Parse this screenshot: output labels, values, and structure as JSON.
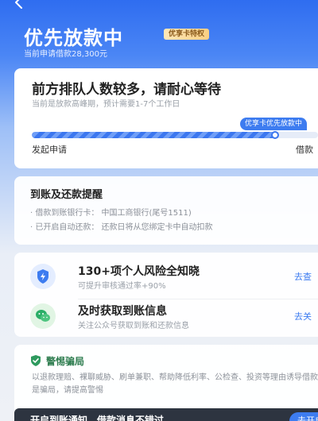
{
  "header": {
    "back_icon": "chevron-left-icon",
    "title": "优先放款中",
    "badge": "优享卡特权",
    "subtitle": "当前申请借款28,300元"
  },
  "queue": {
    "title": "前方排队人数较多，请耐心等待",
    "subtitle": "当前是放款高峰期，预计需要1-7个工作日",
    "tip": "优享卡优先放款中",
    "progress": 0.85,
    "start_label": "发起申请",
    "end_label": "借款"
  },
  "reminder": {
    "title": "到账及还款提醒",
    "line1": "· 借款到账银行卡：  中国工商银行(尾号1511)",
    "line2": "· 已开启自动还款：  还款日将从您绑定卡中自动扣款"
  },
  "features": [
    {
      "icon": "shield-lightning-icon",
      "title": "130+项个人风险全知晓",
      "desc": "可提升审核通过率+90%",
      "action": "去查"
    },
    {
      "icon": "wechat-icon",
      "title": "及时获取到账信息",
      "desc": "关注公众号获取到账和还款信息",
      "action": "去关"
    }
  ],
  "fraud": {
    "icon": "shield-check-icon",
    "title": "警惕骗局",
    "text": "以退款理赔、裸聊威胁、刷单兼职、帮助降低利率、公检查、投资等理由诱导借款的都是骗局，请提高警惕"
  },
  "bottom_bar": {
    "text": "开启到账通知，借款消息不错过",
    "button": "去开启"
  },
  "colors": {
    "accent": "#3d7cf0",
    "header_bg": "#2f6df0",
    "fraud_green": "#2e7d4f"
  }
}
